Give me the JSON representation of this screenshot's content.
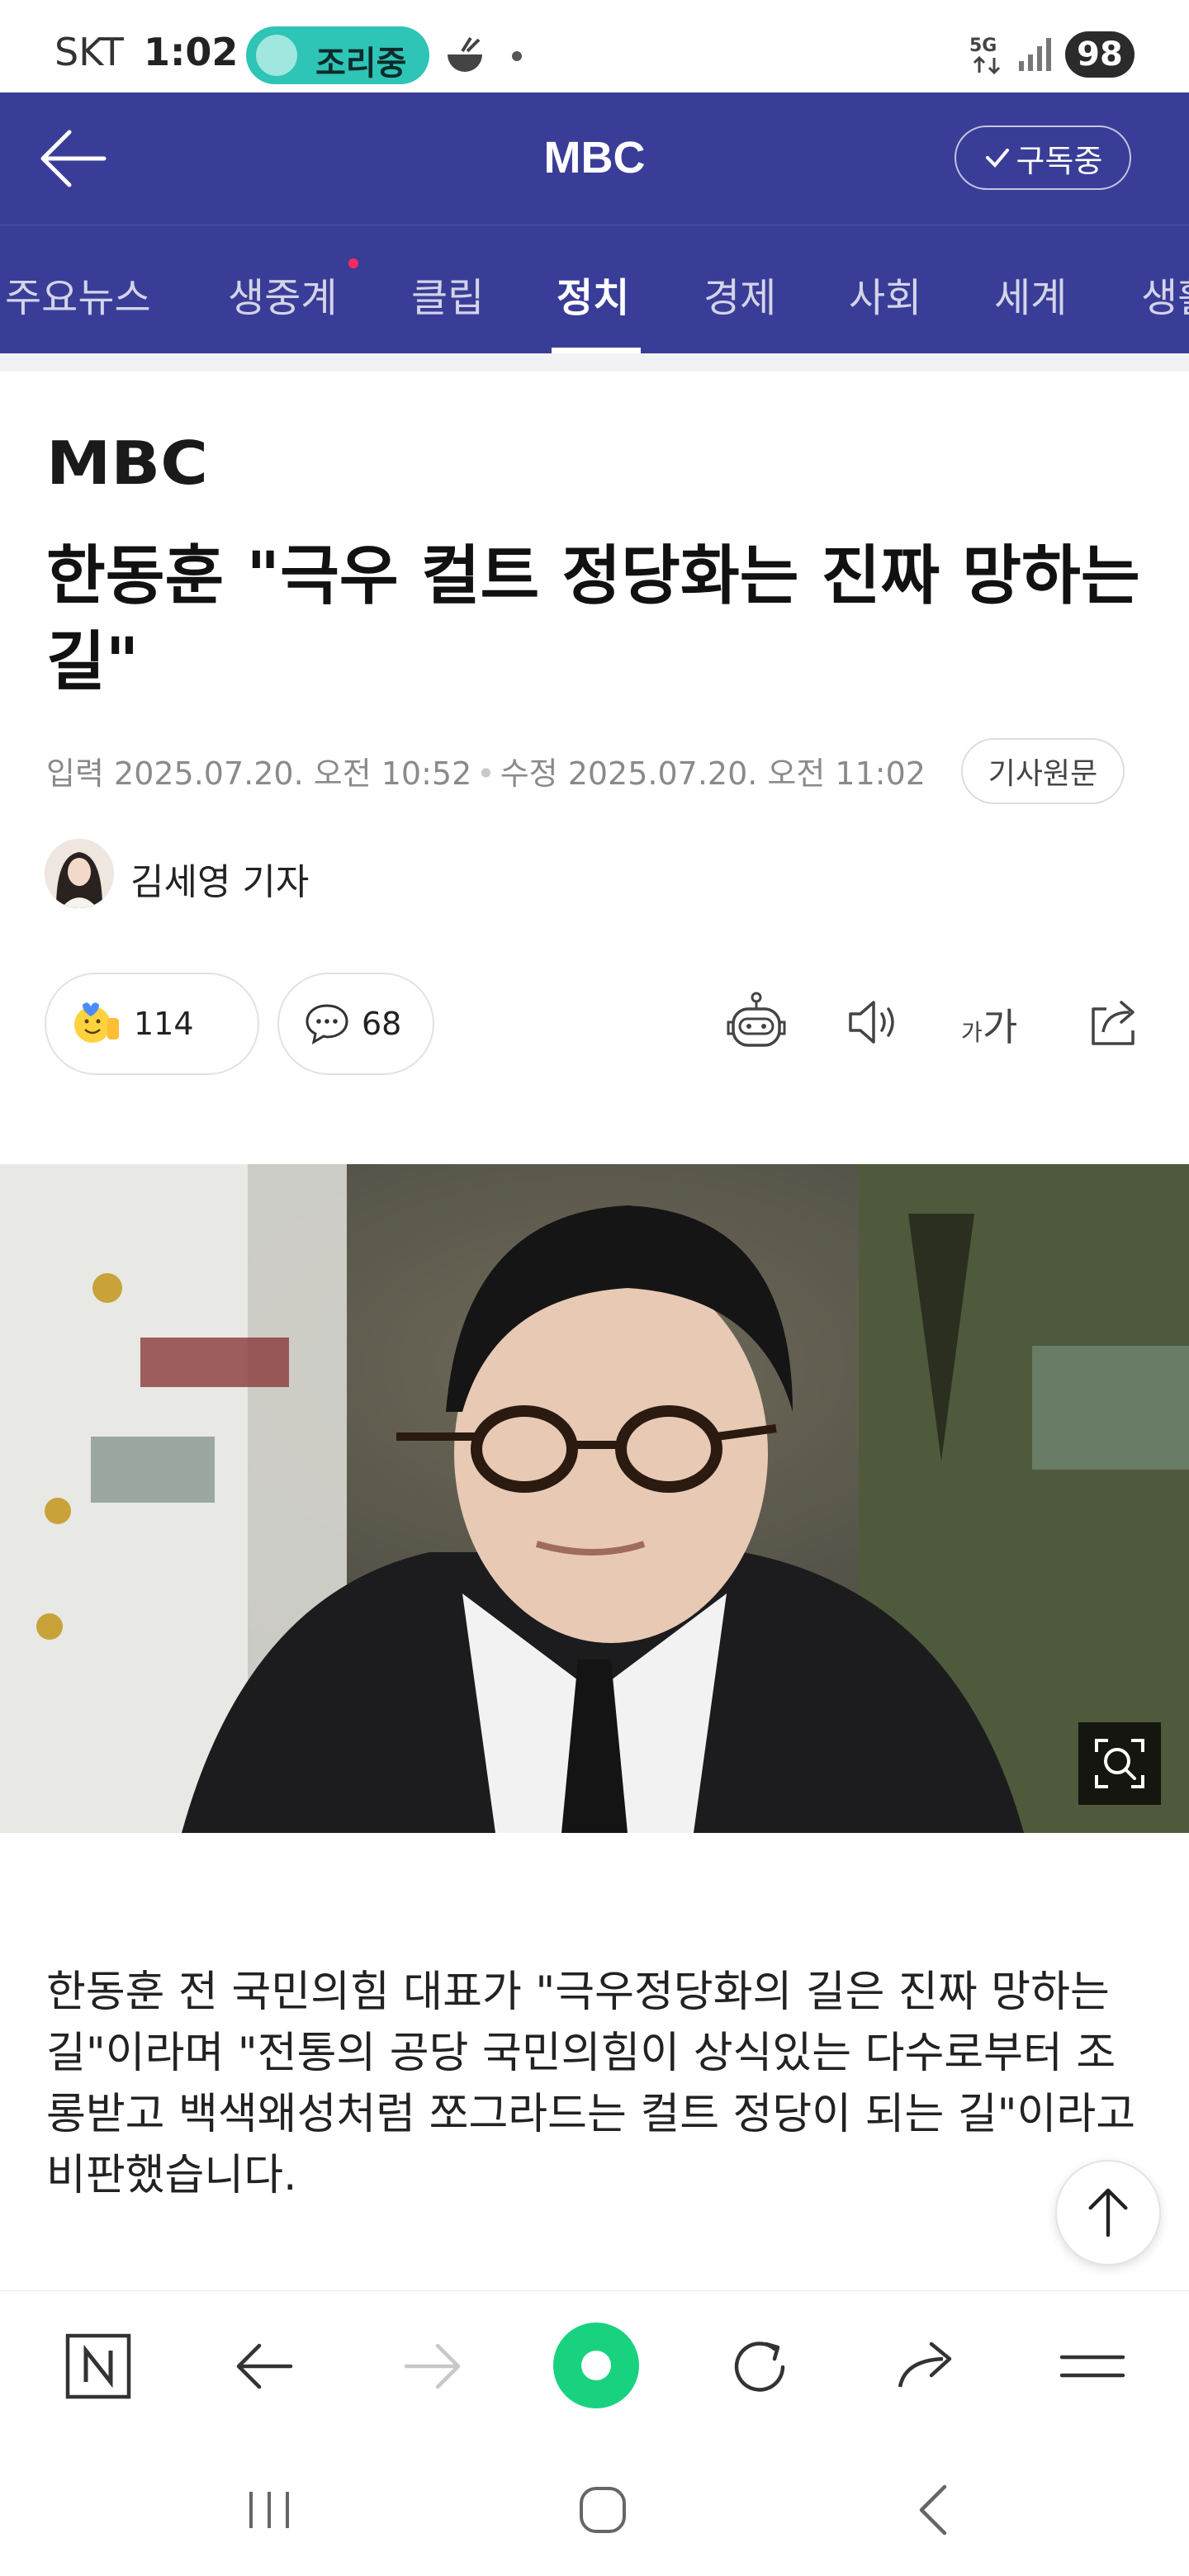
{
  "status_bar": {
    "carrier": "SKT",
    "time": "1:02",
    "cooking_pill": "조리중",
    "battery": "98",
    "network": "5G"
  },
  "header": {
    "title": "MBC",
    "subscribe_label": "구독중"
  },
  "tabs": [
    {
      "label": "주요뉴스",
      "active": false
    },
    {
      "label": "생중계",
      "active": false,
      "has_dot": true
    },
    {
      "label": "클립",
      "active": false
    },
    {
      "label": "정치",
      "active": true
    },
    {
      "label": "경제",
      "active": false
    },
    {
      "label": "사회",
      "active": false
    },
    {
      "label": "세계",
      "active": false
    },
    {
      "label": "생활",
      "active": false
    }
  ],
  "article": {
    "press_logo_text": "MBC",
    "headline": "한동훈 \"극우 컬트 정당화는 진짜 망하는 길\"",
    "published_label": "입력",
    "published": "2025.07.20. 오전 10:52",
    "modified_label": "수정",
    "modified": "2025.07.20. 오전 11:02",
    "original_link_label": "기사원문",
    "author": "김세영 기자",
    "reactions_count": "114",
    "comments_count": "68",
    "font_size_label_small": "가",
    "font_size_label_large": "가",
    "body": "한동훈 전 국민의힘 대표가 \"극우정당화의 길은 진짜 망하는 길\"이라며 \"전통의 공당 국민의힘이 상식있는 다수로부터 조롱받고 백색왜성처럼 쪼그라드는 컬트 정당이 되는 길\"이라고 비판했습니다."
  },
  "colors": {
    "header_bg": "#3a3d97",
    "browser_center": "#18d27f",
    "live_dot": "#ff2a5f",
    "status_pill": "#2ec4b6"
  },
  "icons": {
    "tools": [
      "robot-summary-icon",
      "speaker-icon",
      "font-size-icon",
      "share-icon"
    ],
    "browser_bar": [
      "naver-home-icon",
      "back-arrow-icon",
      "forward-arrow-icon",
      "green-dot-icon",
      "refresh-icon",
      "share-icon",
      "menu-icon"
    ],
    "system_nav": [
      "recents-icon",
      "home-icon",
      "back-icon"
    ]
  }
}
